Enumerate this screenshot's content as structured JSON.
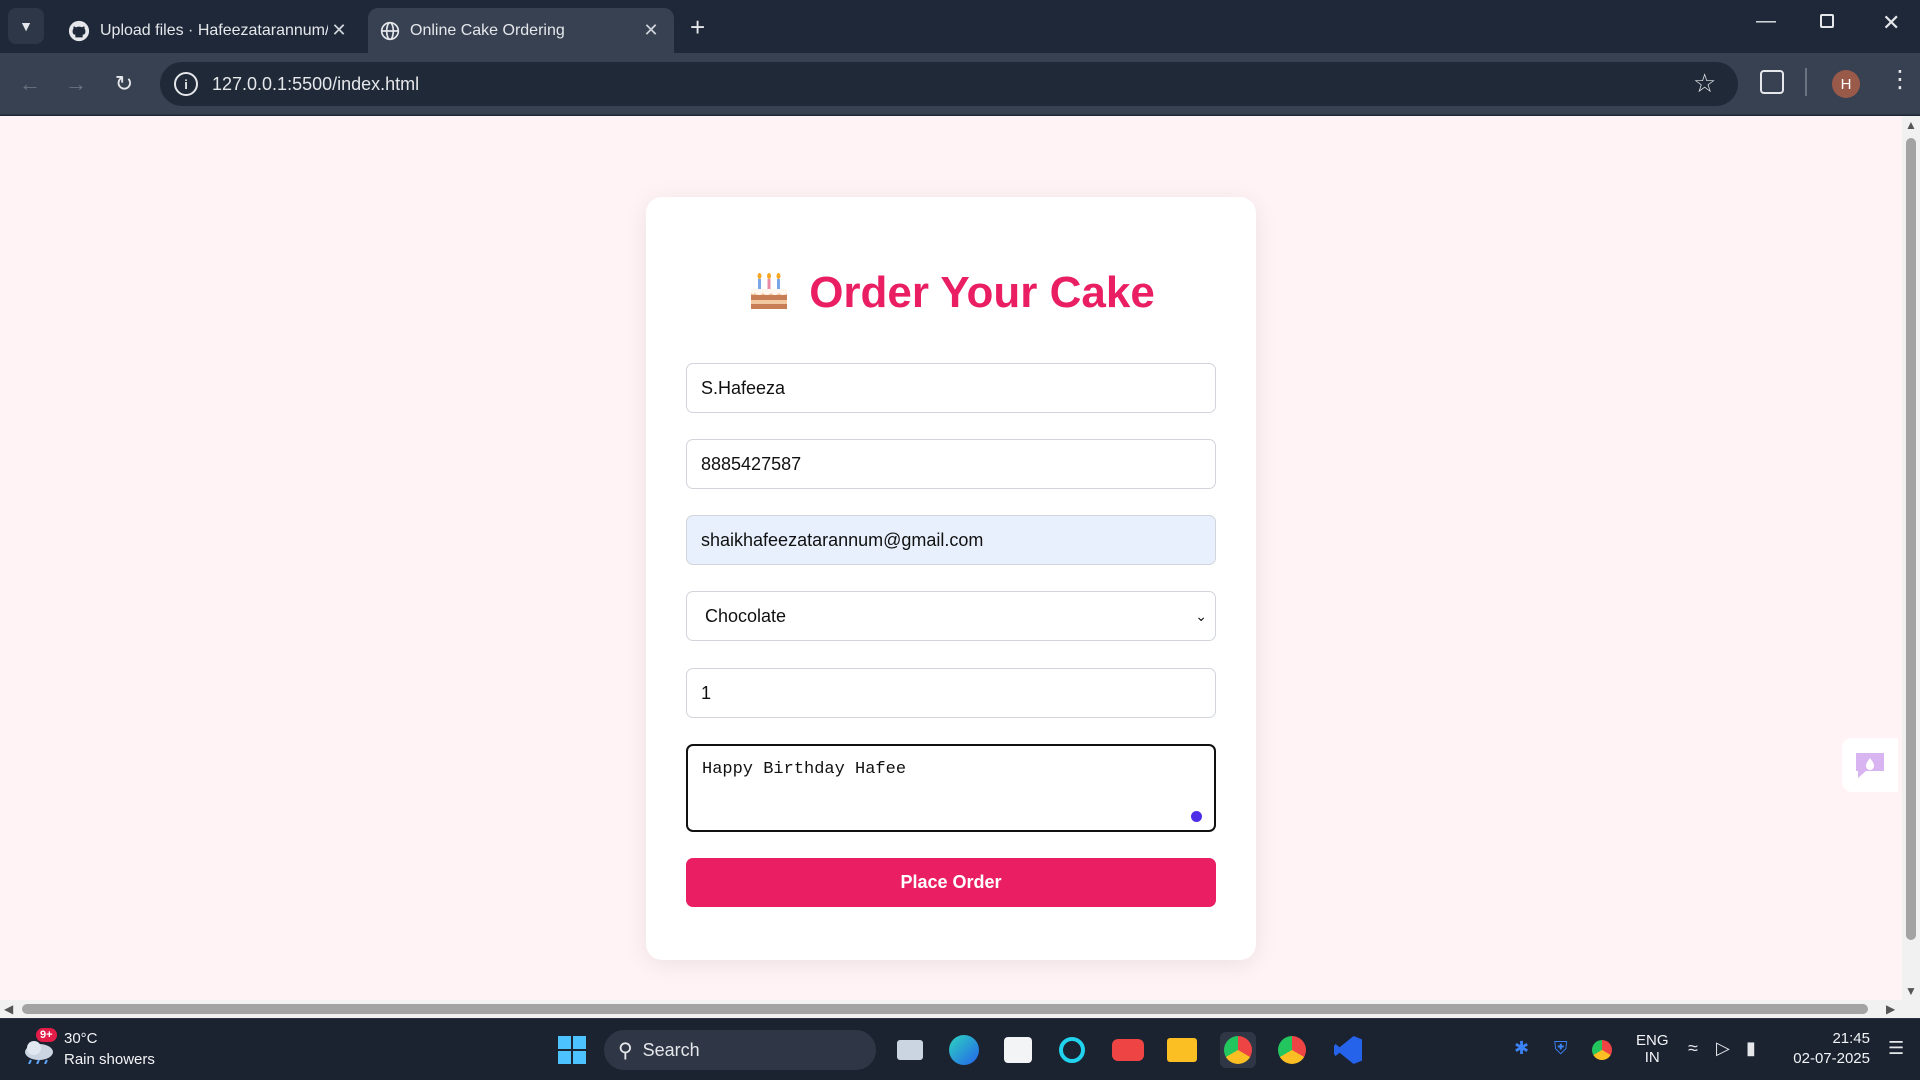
{
  "browser": {
    "tabs": [
      {
        "title": "Upload files · Hafeezatarannum/CS",
        "active": false
      },
      {
        "title": "Online Cake Ordering",
        "active": true
      }
    ],
    "address": "127.0.0.1:5500/index.html",
    "profile_initial": "H"
  },
  "page": {
    "heading": "Order Your Cake",
    "fields": {
      "name": "S.Hafeeza",
      "phone": "8885427587",
      "email": "shaikhafeezatarannum@gmail.com",
      "flavor": "Chocolate",
      "quantity": "1",
      "message": "Happy Birthday Hafee"
    },
    "submit_label": "Place Order",
    "accent_color": "#e91e63"
  },
  "taskbar": {
    "weather": {
      "temp": "30°C",
      "condition": "Rain showers",
      "badge": "9+"
    },
    "search_label": "Search",
    "language": {
      "line1": "ENG",
      "line2": "IN"
    },
    "clock": {
      "time": "21:45",
      "date": "02-07-2025"
    }
  }
}
